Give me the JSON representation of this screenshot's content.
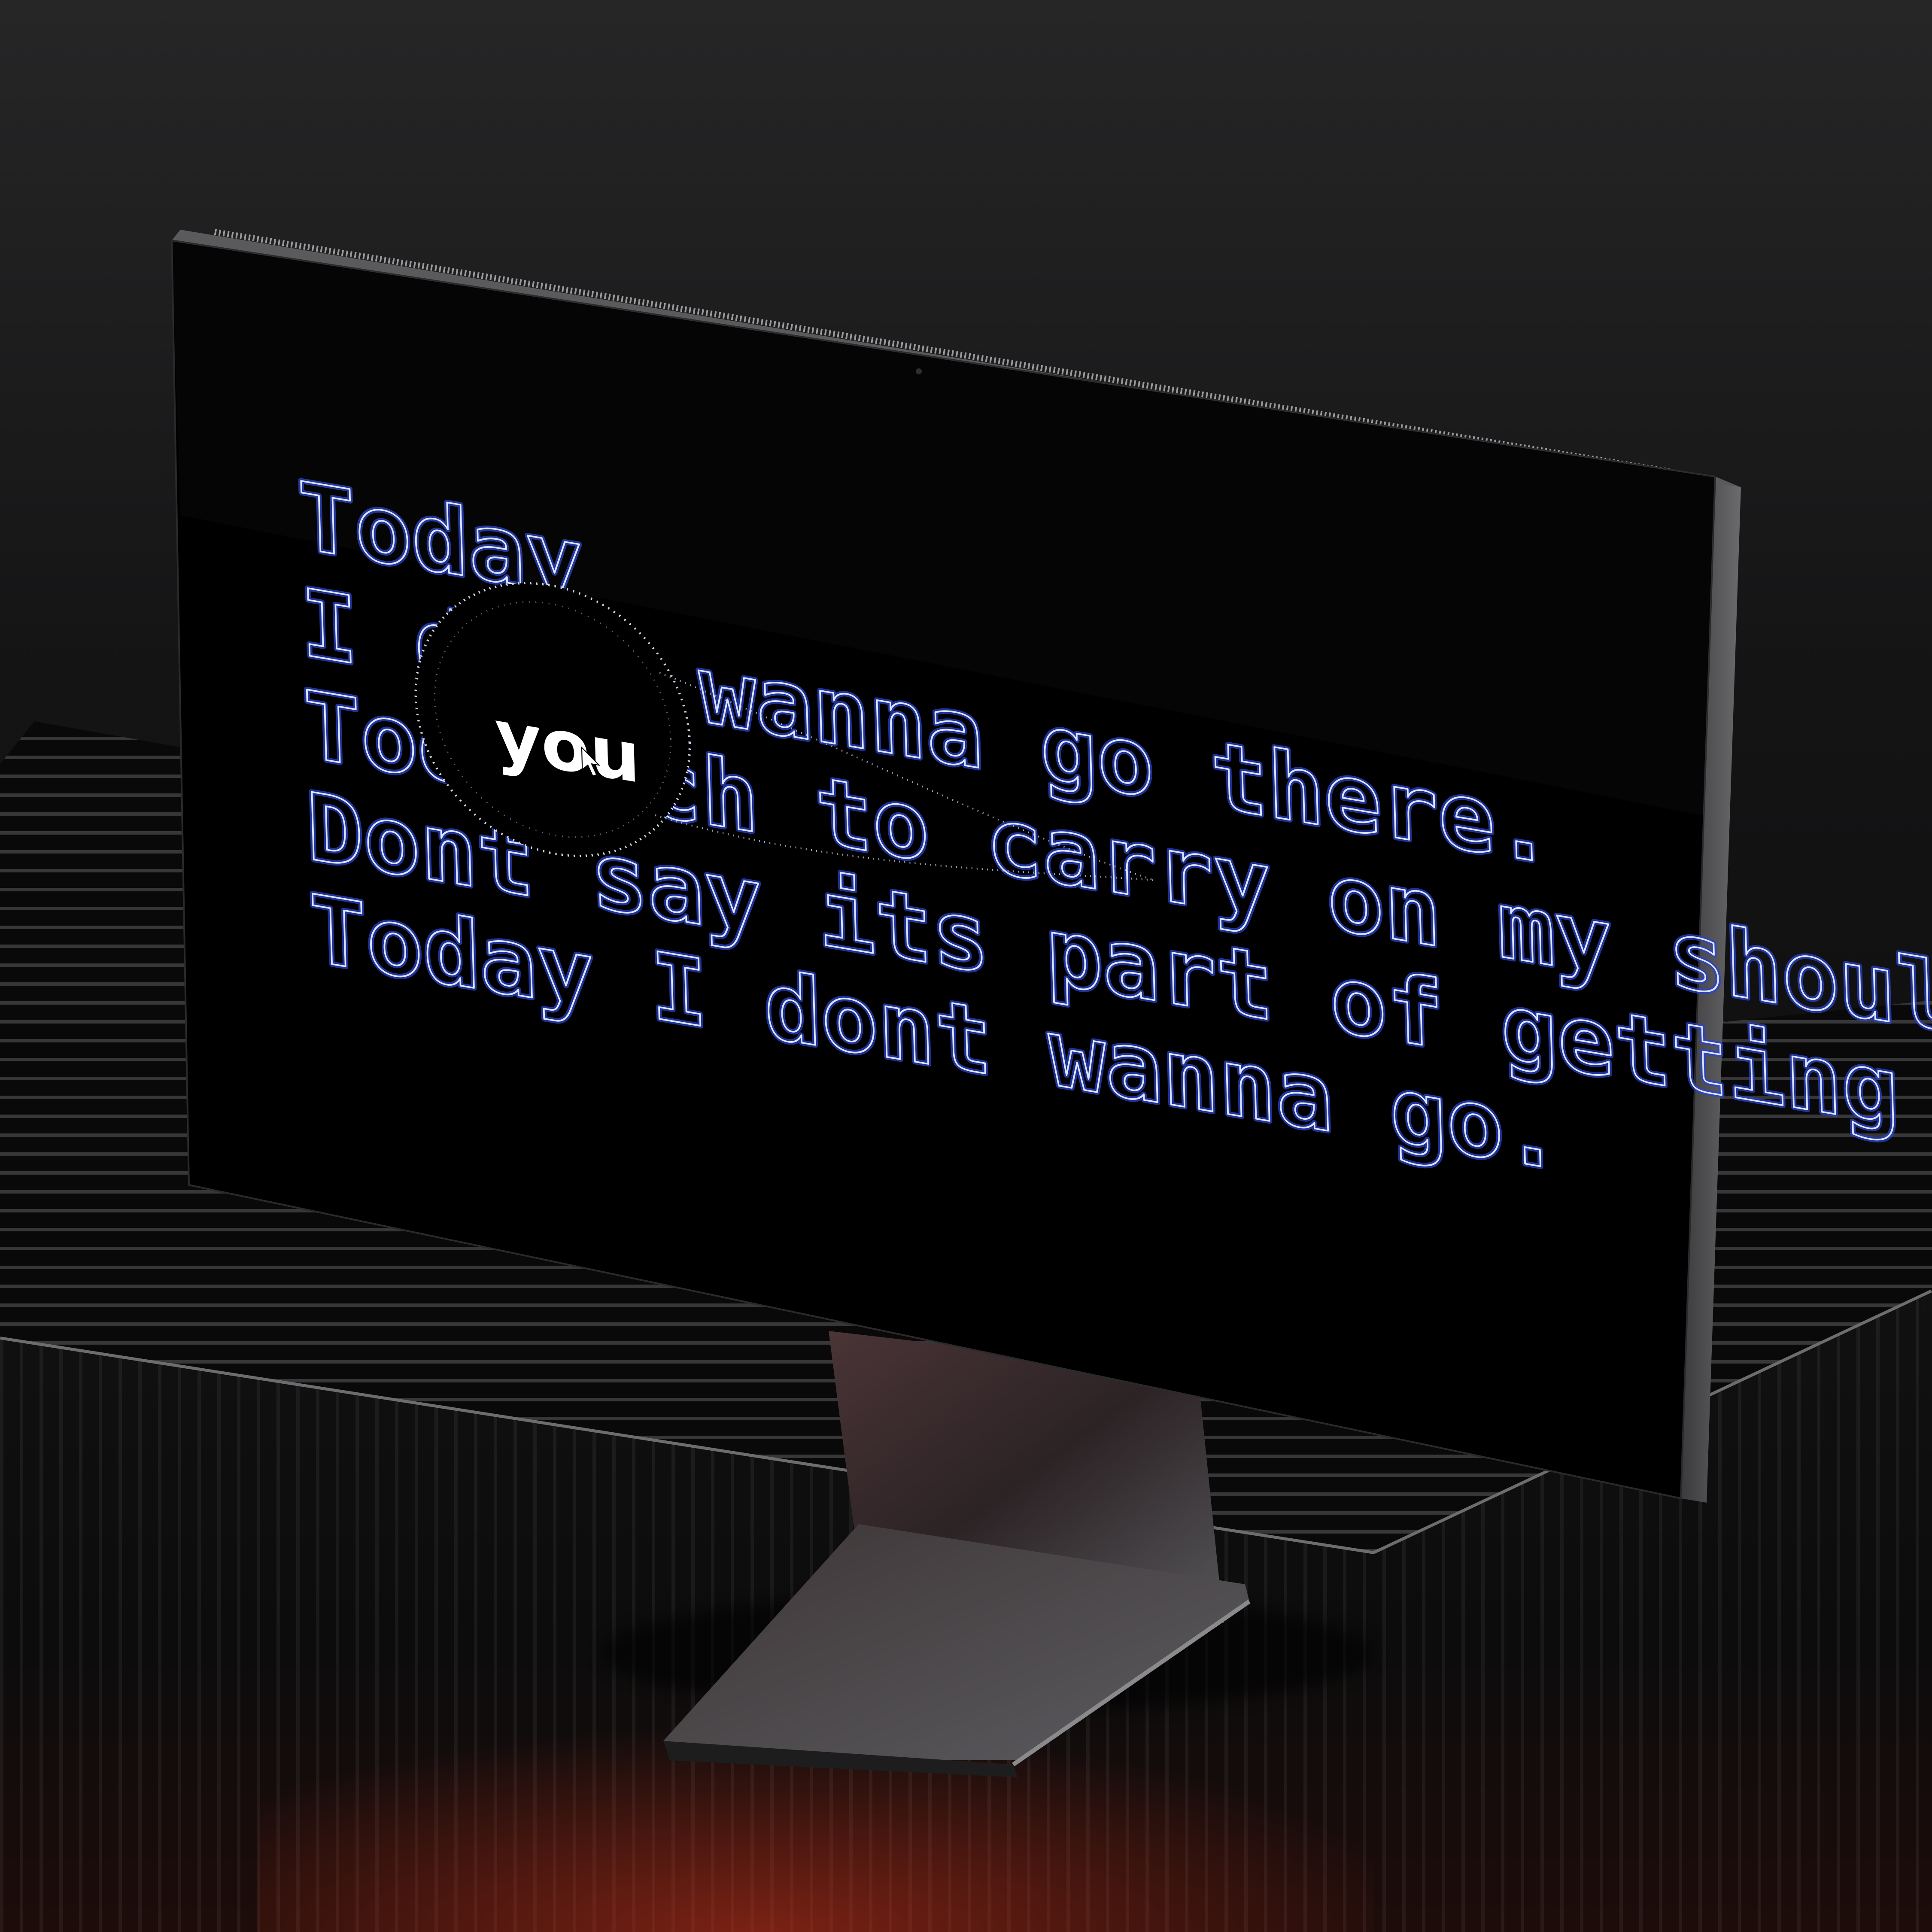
{
  "screen": {
    "lyrics": [
      "Today",
      "I dont wanna go there.",
      "Too much to carry on my shoulder.",
      "Dont say its part of getting older.",
      "Today I dont wanna go."
    ],
    "cursor_word": "you"
  },
  "colors": {
    "background": "#0e0e0f",
    "screen": "#000000",
    "outline_glow": "#2b43c9",
    "outline_core": "#dde6ff",
    "accent_light": "#c7331c"
  }
}
